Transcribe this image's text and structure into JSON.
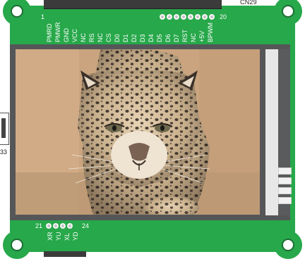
{
  "connector_top": {
    "label": "CN29",
    "first_pin": "1",
    "last_pin": "20"
  },
  "connector_left": {
    "label": "33"
  },
  "connector_bottom": {
    "first_pin": "21",
    "last_pin": "24"
  },
  "top_signals": [
    "PMRD",
    "PMWR",
    "GND",
    "VCC",
    "NC",
    "RS",
    "NC",
    "CS",
    "D0",
    "D1",
    "D2",
    "D3",
    "D4",
    "D5",
    "D6",
    "D7",
    "RST",
    "NC",
    "+5V",
    "BPWM"
  ],
  "bottom_signals": [
    "XR",
    "YU",
    "XL",
    "YD"
  ],
  "display": {
    "image": "leopard-photo"
  }
}
